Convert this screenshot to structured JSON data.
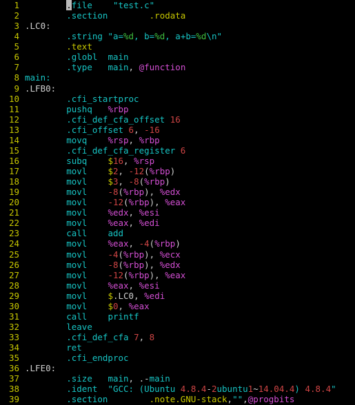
{
  "editor": {
    "app": "assembly-source-view",
    "filename": "test.c",
    "language": "x86-64 AT&T assembly",
    "background_color": "#000000",
    "total_lines": 39,
    "first_visible_line": 1,
    "last_visible_line": 39,
    "cursor": {
      "line": 1,
      "column": 1,
      "character": "."
    }
  },
  "colors": {
    "background": "#000000",
    "line_number": "#c8c800",
    "directive": "#17c4c4",
    "directive_alt": "#c8c800",
    "symbol": "#17c4c4",
    "instruction": "#17c4c4",
    "register": "#d44fd4",
    "number": "#d04545",
    "string": "#17c4c4",
    "format_specifier": "#3fbf3f",
    "at_type": "#d44fd4",
    "plain": "#d0d0d0",
    "cursor": "#b9b9b9"
  },
  "lines": [
    {
      "n": "1",
      "text": ".file\t\"test.c\""
    },
    {
      "n": "2",
      "text": ".section\t.rodata"
    },
    {
      "n": "3",
      "text": ".LC0:"
    },
    {
      "n": "4",
      "text": ".string \"a=%d, b=%d, a+b=%d\\n\""
    },
    {
      "n": "5",
      "text": ".text"
    },
    {
      "n": "6",
      "text": ".globl\tmain"
    },
    {
      "n": "7",
      "text": ".type\tmain, @function"
    },
    {
      "n": "8",
      "text": "main:"
    },
    {
      "n": "9",
      "text": ".LFB0:"
    },
    {
      "n": "10",
      "text": ".cfi_startproc"
    },
    {
      "n": "11",
      "text": "pushq\t%rbp"
    },
    {
      "n": "12",
      "text": ".cfi_def_cfa_offset 16"
    },
    {
      "n": "13",
      "text": ".cfi_offset 6, -16"
    },
    {
      "n": "14",
      "text": "movq\t%rsp, %rbp"
    },
    {
      "n": "15",
      "text": ".cfi_def_cfa_register 6"
    },
    {
      "n": "16",
      "text": "subq\t$16, %rsp"
    },
    {
      "n": "17",
      "text": "movl\t$2, -12(%rbp)"
    },
    {
      "n": "18",
      "text": "movl\t$3, -8(%rbp)"
    },
    {
      "n": "19",
      "text": "movl\t-8(%rbp), %edx"
    },
    {
      "n": "20",
      "text": "movl\t-12(%rbp), %eax"
    },
    {
      "n": "21",
      "text": "movl\t%edx, %esi"
    },
    {
      "n": "22",
      "text": "movl\t%eax, %edi"
    },
    {
      "n": "23",
      "text": "call\tadd"
    },
    {
      "n": "24",
      "text": "movl\t%eax, -4(%rbp)"
    },
    {
      "n": "25",
      "text": "movl\t-4(%rbp), %ecx"
    },
    {
      "n": "26",
      "text": "movl\t-8(%rbp), %edx"
    },
    {
      "n": "27",
      "text": "movl\t-12(%rbp), %eax"
    },
    {
      "n": "28",
      "text": "movl\t%eax, %esi"
    },
    {
      "n": "29",
      "text": "movl\t$.LC0, %edi"
    },
    {
      "n": "30",
      "text": "movl\t$0, %eax"
    },
    {
      "n": "31",
      "text": "call\tprintf"
    },
    {
      "n": "32",
      "text": "leave"
    },
    {
      "n": "33",
      "text": ".cfi_def_cfa 7, 8"
    },
    {
      "n": "34",
      "text": "ret"
    },
    {
      "n": "35",
      "text": ".cfi_endproc"
    },
    {
      "n": "36",
      "text": ".LFE0:"
    },
    {
      "n": "37",
      "text": ".size\tmain, .-main"
    },
    {
      "n": "38",
      "text": ".ident\t\"GCC: (Ubuntu 4.8.4-2ubuntu1~14.04.4) 4.8.4\""
    },
    {
      "n": "39",
      "text": ".section\t.note.GNU-stack,\"\",@progbits"
    }
  ],
  "rendered_lines": [
    {
      "n": "1",
      "indent": 0,
      "tokens": [
        {
          "t": ".",
          "c": "cursor"
        },
        {
          "t": "file",
          "c": "t-dir"
        },
        {
          "t": "    ",
          "c": "t-plain"
        },
        {
          "t": "\"test.c\"",
          "c": "t-str"
        }
      ]
    },
    {
      "n": "2",
      "indent": 0,
      "tokens": [
        {
          "t": ".section",
          "c": "t-dir"
        },
        {
          "t": "        ",
          "c": "t-plain"
        },
        {
          "t": ".rodata",
          "c": "t-dir2"
        }
      ]
    },
    {
      "n": "3",
      "indent": -1,
      "tokens": [
        {
          "t": ".LC0:",
          "c": "t-label"
        }
      ]
    },
    {
      "n": "4",
      "indent": 0,
      "tokens": [
        {
          "t": ".string",
          "c": "t-dir"
        },
        {
          "t": " ",
          "c": "t-plain"
        },
        {
          "t": "\"a=",
          "c": "t-str"
        },
        {
          "t": "%d",
          "c": "t-fmt"
        },
        {
          "t": ", b=",
          "c": "t-str"
        },
        {
          "t": "%d",
          "c": "t-fmt"
        },
        {
          "t": ", a+b=",
          "c": "t-str"
        },
        {
          "t": "%d",
          "c": "t-fmt"
        },
        {
          "t": "\\n\"",
          "c": "t-str"
        }
      ]
    },
    {
      "n": "5",
      "indent": 0,
      "tokens": [
        {
          "t": ".text",
          "c": "t-dir2"
        }
      ]
    },
    {
      "n": "6",
      "indent": 0,
      "tokens": [
        {
          "t": ".globl",
          "c": "t-dir"
        },
        {
          "t": "  ",
          "c": "t-plain"
        },
        {
          "t": "main",
          "c": "t-sym"
        }
      ]
    },
    {
      "n": "7",
      "indent": 0,
      "tokens": [
        {
          "t": ".type",
          "c": "t-dir"
        },
        {
          "t": "   ",
          "c": "t-plain"
        },
        {
          "t": "main",
          "c": "t-sym"
        },
        {
          "t": ", ",
          "c": "t-plain"
        },
        {
          "t": "@function",
          "c": "t-at"
        }
      ]
    },
    {
      "n": "8",
      "indent": -1,
      "tokens": [
        {
          "t": "main:",
          "c": "t-sym"
        }
      ]
    },
    {
      "n": "9",
      "indent": -1,
      "tokens": [
        {
          "t": ".LFB0:",
          "c": "t-label"
        }
      ]
    },
    {
      "n": "10",
      "indent": 0,
      "tokens": [
        {
          "t": ".cfi_startproc",
          "c": "t-dir"
        }
      ]
    },
    {
      "n": "11",
      "indent": 0,
      "tokens": [
        {
          "t": "pushq",
          "c": "t-instr"
        },
        {
          "t": "   ",
          "c": "t-plain"
        },
        {
          "t": "%rbp",
          "c": "t-reg"
        }
      ]
    },
    {
      "n": "12",
      "indent": 0,
      "tokens": [
        {
          "t": ".cfi_def_cfa_offset",
          "c": "t-dir"
        },
        {
          "t": " ",
          "c": "t-plain"
        },
        {
          "t": "16",
          "c": "t-num"
        }
      ]
    },
    {
      "n": "13",
      "indent": 0,
      "tokens": [
        {
          "t": ".cfi_offset",
          "c": "t-dir"
        },
        {
          "t": " ",
          "c": "t-plain"
        },
        {
          "t": "6",
          "c": "t-num"
        },
        {
          "t": ", ",
          "c": "t-plain"
        },
        {
          "t": "-16",
          "c": "t-num"
        }
      ]
    },
    {
      "n": "14",
      "indent": 0,
      "tokens": [
        {
          "t": "movq",
          "c": "t-instr"
        },
        {
          "t": "    ",
          "c": "t-plain"
        },
        {
          "t": "%rsp",
          "c": "t-reg"
        },
        {
          "t": ", ",
          "c": "t-plain"
        },
        {
          "t": "%rbp",
          "c": "t-reg"
        }
      ]
    },
    {
      "n": "15",
      "indent": 0,
      "tokens": [
        {
          "t": ".cfi_def_cfa_register",
          "c": "t-dir"
        },
        {
          "t": " ",
          "c": "t-plain"
        },
        {
          "t": "6",
          "c": "t-num"
        }
      ]
    },
    {
      "n": "16",
      "indent": 0,
      "tokens": [
        {
          "t": "subq",
          "c": "t-instr"
        },
        {
          "t": "    ",
          "c": "t-plain"
        },
        {
          "t": "$",
          "c": "t-dollar"
        },
        {
          "t": "16",
          "c": "t-num"
        },
        {
          "t": ", ",
          "c": "t-plain"
        },
        {
          "t": "%rsp",
          "c": "t-reg"
        }
      ]
    },
    {
      "n": "17",
      "indent": 0,
      "tokens": [
        {
          "t": "movl",
          "c": "t-instr"
        },
        {
          "t": "    ",
          "c": "t-plain"
        },
        {
          "t": "$",
          "c": "t-dollar"
        },
        {
          "t": "2",
          "c": "t-num"
        },
        {
          "t": ", ",
          "c": "t-plain"
        },
        {
          "t": "-12",
          "c": "t-num"
        },
        {
          "t": "(",
          "c": "t-plain"
        },
        {
          "t": "%rbp",
          "c": "t-reg"
        },
        {
          "t": ")",
          "c": "t-plain"
        }
      ]
    },
    {
      "n": "18",
      "indent": 0,
      "tokens": [
        {
          "t": "movl",
          "c": "t-instr"
        },
        {
          "t": "    ",
          "c": "t-plain"
        },
        {
          "t": "$",
          "c": "t-dollar"
        },
        {
          "t": "3",
          "c": "t-num"
        },
        {
          "t": ", ",
          "c": "t-plain"
        },
        {
          "t": "-8",
          "c": "t-num"
        },
        {
          "t": "(",
          "c": "t-plain"
        },
        {
          "t": "%rbp",
          "c": "t-reg"
        },
        {
          "t": ")",
          "c": "t-plain"
        }
      ]
    },
    {
      "n": "19",
      "indent": 0,
      "tokens": [
        {
          "t": "movl",
          "c": "t-instr"
        },
        {
          "t": "    ",
          "c": "t-plain"
        },
        {
          "t": "-8",
          "c": "t-num"
        },
        {
          "t": "(",
          "c": "t-plain"
        },
        {
          "t": "%rbp",
          "c": "t-reg"
        },
        {
          "t": "), ",
          "c": "t-plain"
        },
        {
          "t": "%edx",
          "c": "t-reg"
        }
      ]
    },
    {
      "n": "20",
      "indent": 0,
      "tokens": [
        {
          "t": "movl",
          "c": "t-instr"
        },
        {
          "t": "    ",
          "c": "t-plain"
        },
        {
          "t": "-12",
          "c": "t-num"
        },
        {
          "t": "(",
          "c": "t-plain"
        },
        {
          "t": "%rbp",
          "c": "t-reg"
        },
        {
          "t": "), ",
          "c": "t-plain"
        },
        {
          "t": "%eax",
          "c": "t-reg"
        }
      ]
    },
    {
      "n": "21",
      "indent": 0,
      "tokens": [
        {
          "t": "movl",
          "c": "t-instr"
        },
        {
          "t": "    ",
          "c": "t-plain"
        },
        {
          "t": "%edx",
          "c": "t-reg"
        },
        {
          "t": ", ",
          "c": "t-plain"
        },
        {
          "t": "%esi",
          "c": "t-reg"
        }
      ]
    },
    {
      "n": "22",
      "indent": 0,
      "tokens": [
        {
          "t": "movl",
          "c": "t-instr"
        },
        {
          "t": "    ",
          "c": "t-plain"
        },
        {
          "t": "%eax",
          "c": "t-reg"
        },
        {
          "t": ", ",
          "c": "t-plain"
        },
        {
          "t": "%edi",
          "c": "t-reg"
        }
      ]
    },
    {
      "n": "23",
      "indent": 0,
      "tokens": [
        {
          "t": "call",
          "c": "t-instr"
        },
        {
          "t": "    ",
          "c": "t-plain"
        },
        {
          "t": "add",
          "c": "t-sym"
        }
      ]
    },
    {
      "n": "24",
      "indent": 0,
      "tokens": [
        {
          "t": "movl",
          "c": "t-instr"
        },
        {
          "t": "    ",
          "c": "t-plain"
        },
        {
          "t": "%eax",
          "c": "t-reg"
        },
        {
          "t": ", ",
          "c": "t-plain"
        },
        {
          "t": "-4",
          "c": "t-num"
        },
        {
          "t": "(",
          "c": "t-plain"
        },
        {
          "t": "%rbp",
          "c": "t-reg"
        },
        {
          "t": ")",
          "c": "t-plain"
        }
      ]
    },
    {
      "n": "25",
      "indent": 0,
      "tokens": [
        {
          "t": "movl",
          "c": "t-instr"
        },
        {
          "t": "    ",
          "c": "t-plain"
        },
        {
          "t": "-4",
          "c": "t-num"
        },
        {
          "t": "(",
          "c": "t-plain"
        },
        {
          "t": "%rbp",
          "c": "t-reg"
        },
        {
          "t": "), ",
          "c": "t-plain"
        },
        {
          "t": "%ecx",
          "c": "t-reg"
        }
      ]
    },
    {
      "n": "26",
      "indent": 0,
      "tokens": [
        {
          "t": "movl",
          "c": "t-instr"
        },
        {
          "t": "    ",
          "c": "t-plain"
        },
        {
          "t": "-8",
          "c": "t-num"
        },
        {
          "t": "(",
          "c": "t-plain"
        },
        {
          "t": "%rbp",
          "c": "t-reg"
        },
        {
          "t": "), ",
          "c": "t-plain"
        },
        {
          "t": "%edx",
          "c": "t-reg"
        }
      ]
    },
    {
      "n": "27",
      "indent": 0,
      "tokens": [
        {
          "t": "movl",
          "c": "t-instr"
        },
        {
          "t": "    ",
          "c": "t-plain"
        },
        {
          "t": "-12",
          "c": "t-num"
        },
        {
          "t": "(",
          "c": "t-plain"
        },
        {
          "t": "%rbp",
          "c": "t-reg"
        },
        {
          "t": "), ",
          "c": "t-plain"
        },
        {
          "t": "%eax",
          "c": "t-reg"
        }
      ]
    },
    {
      "n": "28",
      "indent": 0,
      "tokens": [
        {
          "t": "movl",
          "c": "t-instr"
        },
        {
          "t": "    ",
          "c": "t-plain"
        },
        {
          "t": "%eax",
          "c": "t-reg"
        },
        {
          "t": ", ",
          "c": "t-plain"
        },
        {
          "t": "%esi",
          "c": "t-reg"
        }
      ]
    },
    {
      "n": "29",
      "indent": 0,
      "tokens": [
        {
          "t": "movl",
          "c": "t-instr"
        },
        {
          "t": "    ",
          "c": "t-plain"
        },
        {
          "t": "$",
          "c": "t-dollar"
        },
        {
          "t": ".LC0",
          "c": "t-label"
        },
        {
          "t": ", ",
          "c": "t-plain"
        },
        {
          "t": "%edi",
          "c": "t-reg"
        }
      ]
    },
    {
      "n": "30",
      "indent": 0,
      "tokens": [
        {
          "t": "movl",
          "c": "t-instr"
        },
        {
          "t": "    ",
          "c": "t-plain"
        },
        {
          "t": "$",
          "c": "t-dollar"
        },
        {
          "t": "0",
          "c": "t-num"
        },
        {
          "t": ", ",
          "c": "t-plain"
        },
        {
          "t": "%eax",
          "c": "t-reg"
        }
      ]
    },
    {
      "n": "31",
      "indent": 0,
      "tokens": [
        {
          "t": "call",
          "c": "t-instr"
        },
        {
          "t": "    ",
          "c": "t-plain"
        },
        {
          "t": "printf",
          "c": "t-sym"
        }
      ]
    },
    {
      "n": "32",
      "indent": 0,
      "tokens": [
        {
          "t": "leave",
          "c": "t-instr"
        }
      ]
    },
    {
      "n": "33",
      "indent": 0,
      "tokens": [
        {
          "t": ".cfi_def_cfa",
          "c": "t-dir"
        },
        {
          "t": " ",
          "c": "t-plain"
        },
        {
          "t": "7",
          "c": "t-num"
        },
        {
          "t": ", ",
          "c": "t-plain"
        },
        {
          "t": "8",
          "c": "t-num"
        }
      ]
    },
    {
      "n": "34",
      "indent": 0,
      "tokens": [
        {
          "t": "ret",
          "c": "t-instr"
        }
      ]
    },
    {
      "n": "35",
      "indent": 0,
      "tokens": [
        {
          "t": ".cfi_endproc",
          "c": "t-dir"
        }
      ]
    },
    {
      "n": "36",
      "indent": -1,
      "tokens": [
        {
          "t": ".LFE0:",
          "c": "t-label"
        }
      ]
    },
    {
      "n": "37",
      "indent": 0,
      "tokens": [
        {
          "t": ".size",
          "c": "t-dir"
        },
        {
          "t": "   ",
          "c": "t-plain"
        },
        {
          "t": "main",
          "c": "t-sym"
        },
        {
          "t": ", .-",
          "c": "t-plain"
        },
        {
          "t": "main",
          "c": "t-sym"
        }
      ]
    },
    {
      "n": "38",
      "indent": 0,
      "tokens": [
        {
          "t": ".ident",
          "c": "t-dir"
        },
        {
          "t": "  ",
          "c": "t-plain"
        },
        {
          "t": "\"GCC: (Ubuntu ",
          "c": "t-str"
        },
        {
          "t": "4.8.4",
          "c": "t-num"
        },
        {
          "t": "-",
          "c": "t-plain"
        },
        {
          "t": "2",
          "c": "t-num"
        },
        {
          "t": "ubuntu",
          "c": "t-str"
        },
        {
          "t": "1",
          "c": "t-num"
        },
        {
          "t": "~",
          "c": "t-plain"
        },
        {
          "t": "14.04.4",
          "c": "t-num"
        },
        {
          "t": ") ",
          "c": "t-str"
        },
        {
          "t": "4.8.4",
          "c": "t-num"
        },
        {
          "t": "\"",
          "c": "t-str"
        }
      ]
    },
    {
      "n": "39",
      "indent": 0,
      "tokens": [
        {
          "t": ".section",
          "c": "t-dir"
        },
        {
          "t": "        ",
          "c": "t-plain"
        },
        {
          "t": ".note.GNU-stack",
          "c": "t-dir2"
        },
        {
          "t": ",",
          "c": "t-plain"
        },
        {
          "t": "\"\"",
          "c": "t-str"
        },
        {
          "t": ",",
          "c": "t-plain"
        },
        {
          "t": "@progbits",
          "c": "t-at"
        }
      ]
    }
  ]
}
